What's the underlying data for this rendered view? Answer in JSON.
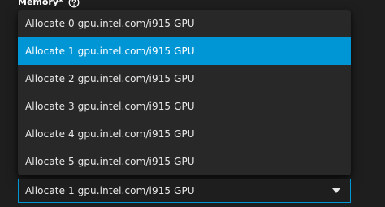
{
  "field": {
    "label": "Memory",
    "required_marker": "*",
    "help_icon": "question-circle-icon"
  },
  "dropdown": {
    "options": [
      "Allocate 0 gpu.intel.com/i915 GPU",
      "Allocate 1 gpu.intel.com/i915 GPU",
      "Allocate 2 gpu.intel.com/i915 GPU",
      "Allocate 3 gpu.intel.com/i915 GPU",
      "Allocate 4 gpu.intel.com/i915 GPU",
      "Allocate 5 gpu.intel.com/i915 GPU"
    ],
    "selected_index": 1,
    "selected_value": "Allocate 1 gpu.intel.com/i915 GPU",
    "expand_icon": "triangle-down-icon"
  },
  "colors": {
    "accent": "#0095d5",
    "background": "#1e1e1e",
    "menu_background": "#282828",
    "text": "#e8e8e8"
  }
}
